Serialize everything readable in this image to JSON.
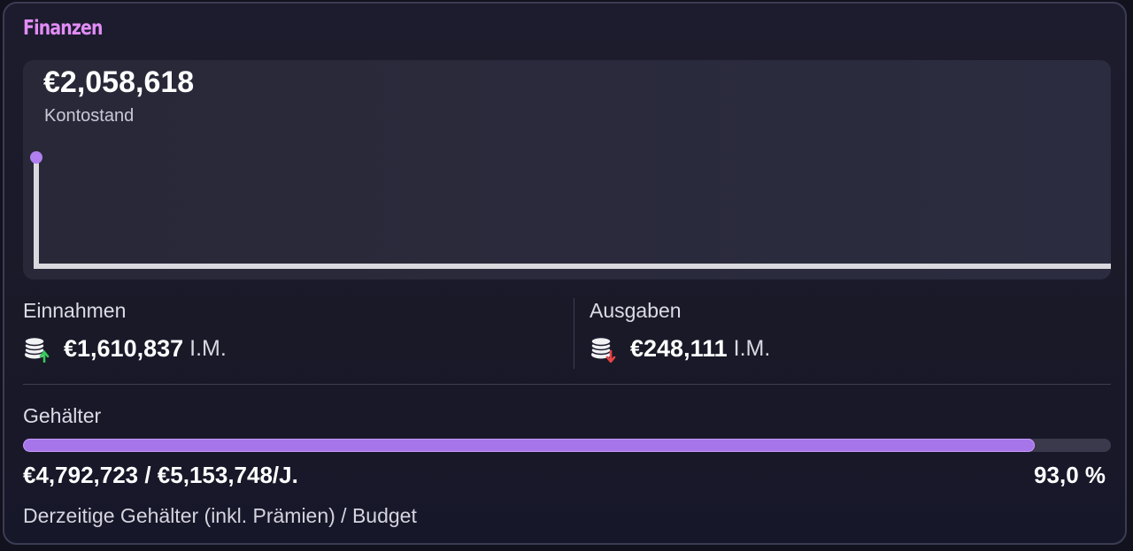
{
  "panel": {
    "title": "Finanzen"
  },
  "balance": {
    "value": "€2,058,618",
    "label": "Kontostand",
    "line_color": "#d9d9de",
    "point_color": "#b07ff0"
  },
  "income": {
    "label": "Einnahmen",
    "value": "€1,610,837",
    "unit": "I.M.",
    "icon": "coins-up-icon",
    "arrow_color": "#38c75a"
  },
  "expenses": {
    "label": "Ausgaben",
    "value": "€248,111",
    "unit": "I.M.",
    "icon": "coins-down-icon",
    "arrow_color": "#e64545"
  },
  "salaries": {
    "label": "Gehälter",
    "values": "€4,792,723 / €5,153,748/J.",
    "percent": "93,0 %",
    "fraction": 0.93,
    "caption": "Derzeitige Gehälter (inkl. Prämien) / Budget",
    "bar_color": "#a775ea"
  },
  "colors": {
    "title_accent": "#e28cf6",
    "background": "#1b1b2c"
  }
}
